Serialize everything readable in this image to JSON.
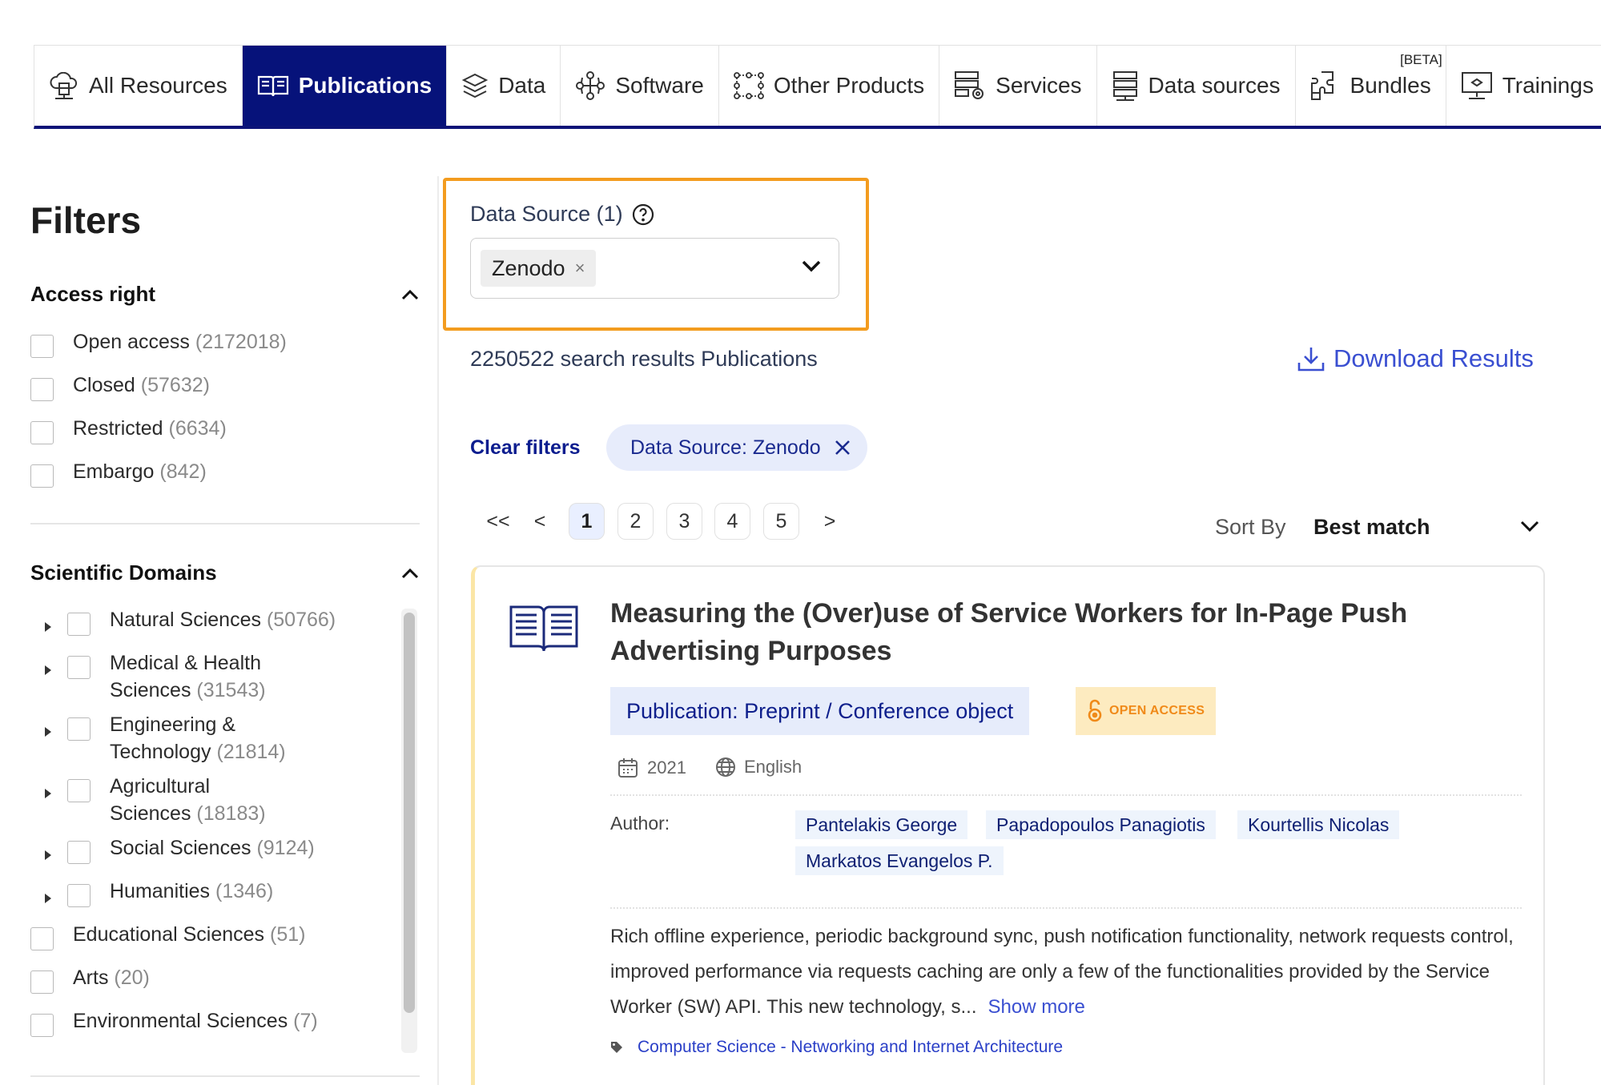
{
  "tabs": [
    {
      "label": "All Resources",
      "icon": "cloud-network-icon",
      "active": false
    },
    {
      "label": "Publications",
      "icon": "open-book-icon",
      "active": true
    },
    {
      "label": "Data",
      "icon": "layers-icon",
      "active": false
    },
    {
      "label": "Software",
      "icon": "software-nodes-icon",
      "active": false
    },
    {
      "label": "Other Products",
      "icon": "nodes-grid-icon",
      "active": false
    },
    {
      "label": "Services",
      "icon": "server-gear-icon",
      "active": false
    },
    {
      "label": "Data sources",
      "icon": "server-rack-icon",
      "active": false
    },
    {
      "label": "Bundles",
      "icon": "puzzle-icon",
      "active": false,
      "badge": "[BETA]"
    },
    {
      "label": "Trainings",
      "icon": "presentation-icon",
      "active": false
    }
  ],
  "filters": {
    "title": "Filters",
    "access_right": {
      "title": "Access right",
      "items": [
        {
          "label": "Open access",
          "count": "(2172018)"
        },
        {
          "label": "Closed",
          "count": "(57632)"
        },
        {
          "label": "Restricted",
          "count": "(6634)"
        },
        {
          "label": "Embargo",
          "count": "(842)"
        }
      ]
    },
    "scientific_domains": {
      "title": "Scientific Domains",
      "items": [
        {
          "line1": "Natural Sciences",
          "line2": "",
          "count": "(50766)",
          "expandable": true
        },
        {
          "line1": "Medical & Health",
          "line2": "Sciences",
          "count": "(31543)",
          "expandable": true
        },
        {
          "line1": "Engineering &",
          "line2": "Technology",
          "count": "(21814)",
          "expandable": true
        },
        {
          "line1": "Agricultural",
          "line2": "Sciences",
          "count": "(18183)",
          "expandable": true
        },
        {
          "line1": "Social Sciences",
          "line2": "",
          "count": "(9124)",
          "expandable": true
        },
        {
          "line1": "Humanities",
          "line2": "",
          "count": "(1346)",
          "expandable": true
        },
        {
          "line1": "Educational Sciences",
          "line2": "",
          "count": "(51)",
          "expandable": false
        },
        {
          "line1": "Arts",
          "line2": "",
          "count": "(20)",
          "expandable": false
        },
        {
          "line1": "Environmental Sciences",
          "line2": "",
          "count": "(7)",
          "expandable": false
        }
      ]
    }
  },
  "data_source": {
    "label": "Data Source (1)",
    "selected": "Zenodo",
    "remove_glyph": "×"
  },
  "results": {
    "count_text": "2250522 search results Publications",
    "download_label": "Download Results",
    "clear_filters": "Clear filters",
    "active_filter": "Data Source: Zenodo"
  },
  "pagination": {
    "first": "<<",
    "prev": "<",
    "pages": [
      "1",
      "2",
      "3",
      "4",
      "5"
    ],
    "current": "1",
    "next": ">"
  },
  "sort": {
    "label": "Sort By",
    "value": "Best match"
  },
  "result": {
    "title": "Measuring the (Over)use of Service Workers for In-Page Push Advertising Purposes",
    "type": "Publication: Preprint / Conference object",
    "access_badge": "OPEN ACCESS",
    "year": "2021",
    "language": "English",
    "author_label": "Author:",
    "authors": [
      "Pantelakis George",
      "Papadopoulos Panagiotis",
      "Kourtellis Nicolas",
      "Markatos Evangelos P."
    ],
    "abstract": "Rich offline experience, periodic background sync, push notification functionality, network requests control, improved performance via requests caching are only a few of the functionalities provided by the Service Worker (SW) API. This new technology, s...",
    "show_more": "Show more",
    "tag": "Computer Science - Networking and Internet Architecture"
  },
  "colors": {
    "active_tab": "#06127a",
    "highlight_border": "#f39c1f",
    "link": "#3a4fd1",
    "open_access": "#f08a19"
  }
}
